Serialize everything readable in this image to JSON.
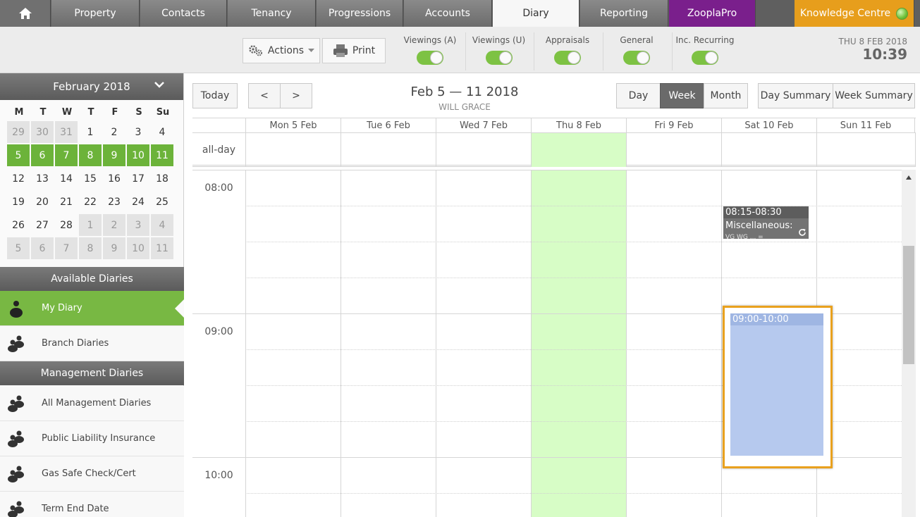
{
  "nav": {
    "tabs": [
      "Property",
      "Contacts",
      "Tenancy",
      "Progressions",
      "Accounts",
      "Diary",
      "Reporting",
      "ZooplaPro"
    ],
    "active_tab": "Diary",
    "knowledge_centre": "Knowledge Centre",
    "colors": {
      "zoopla": "#7a1f8c",
      "knowledge": "#e79e1c",
      "accent_green": "#6cb33a"
    }
  },
  "toolbar": {
    "actions_label": "Actions",
    "print_label": "Print",
    "toggles": [
      {
        "label": "Viewings (A)",
        "on": true
      },
      {
        "label": "Viewings (U)",
        "on": true
      },
      {
        "label": "Appraisals",
        "on": true
      },
      {
        "label": "General",
        "on": true
      },
      {
        "label": "Inc. Recurring",
        "on": true
      }
    ],
    "date": "THU 8 FEB 2018",
    "time": "10:39"
  },
  "mini_calendar": {
    "title": "February 2018",
    "dow": [
      "M",
      "T",
      "W",
      "T",
      "F",
      "S",
      "Su"
    ],
    "weeks": [
      [
        {
          "d": "29",
          "o": true
        },
        {
          "d": "30",
          "o": true
        },
        {
          "d": "31",
          "o": true
        },
        {
          "d": "1"
        },
        {
          "d": "2"
        },
        {
          "d": "3"
        },
        {
          "d": "4"
        }
      ],
      [
        {
          "d": "5",
          "s": true
        },
        {
          "d": "6",
          "s": true
        },
        {
          "d": "7",
          "s": true
        },
        {
          "d": "8",
          "s": true
        },
        {
          "d": "9",
          "s": true
        },
        {
          "d": "10",
          "s": true
        },
        {
          "d": "11",
          "s": true
        }
      ],
      [
        {
          "d": "12"
        },
        {
          "d": "13"
        },
        {
          "d": "14"
        },
        {
          "d": "15"
        },
        {
          "d": "16"
        },
        {
          "d": "17"
        },
        {
          "d": "18"
        }
      ],
      [
        {
          "d": "19"
        },
        {
          "d": "20"
        },
        {
          "d": "21"
        },
        {
          "d": "22"
        },
        {
          "d": "23"
        },
        {
          "d": "24"
        },
        {
          "d": "25"
        }
      ],
      [
        {
          "d": "26"
        },
        {
          "d": "27"
        },
        {
          "d": "28"
        },
        {
          "d": "1",
          "o": true
        },
        {
          "d": "2",
          "o": true
        },
        {
          "d": "3",
          "o": true
        },
        {
          "d": "4",
          "o": true
        }
      ],
      [
        {
          "d": "5",
          "o": true
        },
        {
          "d": "6",
          "o": true
        },
        {
          "d": "7",
          "o": true
        },
        {
          "d": "8",
          "o": true
        },
        {
          "d": "9",
          "o": true
        },
        {
          "d": "10",
          "o": true
        },
        {
          "d": "11",
          "o": true
        }
      ]
    ]
  },
  "sidebar": {
    "available_title": "Available Diaries",
    "my_diary": "My Diary",
    "branch_diaries": "Branch Diaries",
    "management_title": "Management Diaries",
    "management_items": [
      "All Management Diaries",
      "Public Liability Insurance",
      "Gas Safe Check/Cert",
      "Term End Date"
    ]
  },
  "calendar": {
    "today_label": "Today",
    "prev_label": "<",
    "next_label": ">",
    "title": "Feb 5 — 11 2018",
    "subtitle": "WILL GRACE",
    "view_day": "Day",
    "view_week": "Week",
    "view_month": "Month",
    "day_summary": "Day Summary",
    "week_summary": "Week Summary",
    "days": [
      "Mon 5 Feb",
      "Tue 6 Feb",
      "Wed 7 Feb",
      "Thu 8 Feb",
      "Fri 9 Feb",
      "Sat 10 Feb",
      "Sun 11 Feb"
    ],
    "allday_label": "all-day",
    "hours": [
      "08:00",
      "09:00",
      "10:00"
    ],
    "events": {
      "misc": {
        "time": "08:15-08:30",
        "title": "Miscellaneous:",
        "detail": "VG WG ... ="
      },
      "selected": {
        "time": "09:00-10:00"
      }
    }
  }
}
